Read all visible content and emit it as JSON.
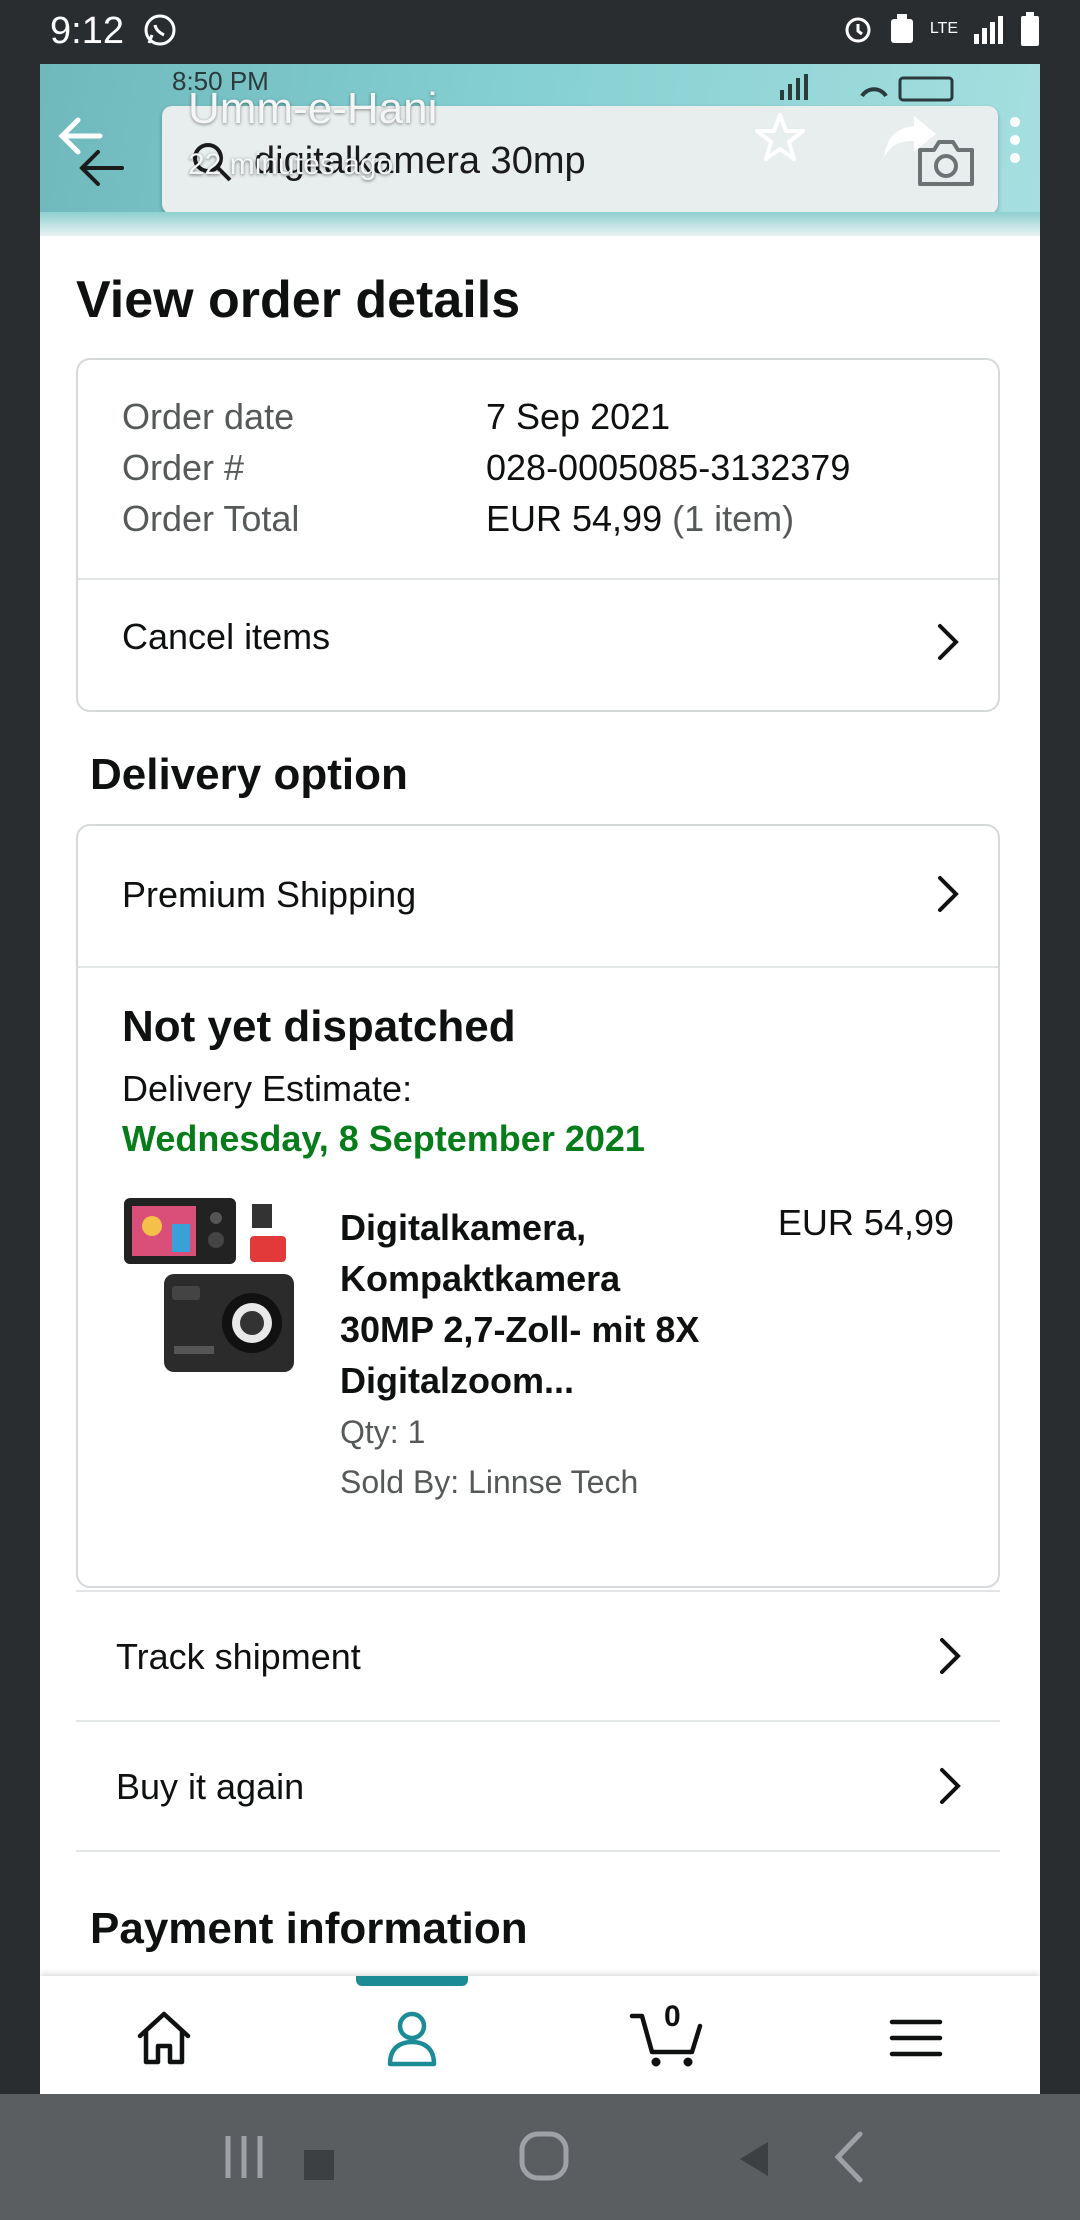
{
  "status_bar": {
    "time": "9:12",
    "network": "LTE"
  },
  "story_overlay": {
    "name": "Umm-e-Hani",
    "time_ago": "22 minutes ago"
  },
  "inner_status": {
    "time": "8:50 PM",
    "battery": "90"
  },
  "search": {
    "query": "digitalkamera 30mp"
  },
  "page": {
    "title": "View order details"
  },
  "order": {
    "date_label": "Order date",
    "date_value": "7 Sep 2021",
    "number_label": "Order #",
    "number_value": "028-0005085-3132379",
    "total_label": "Order Total",
    "total_value": "EUR 54,99",
    "total_items": "(1 item)",
    "cancel_label": "Cancel items"
  },
  "delivery": {
    "section_title": "Delivery option",
    "shipping_option": "Premium Shipping",
    "status": "Not yet dispatched",
    "estimate_label": "Delivery Estimate:",
    "estimate_date": "Wednesday, 8 September 2021",
    "product": {
      "title_lines": [
        "Digitalkamera,",
        "Kompaktkamera",
        "30MP 2,7-Zoll- mit 8X",
        "Digitalzoom..."
      ],
      "price": "EUR 54,99",
      "qty": "Qty: 1",
      "seller": "Sold By: Linnse Tech"
    }
  },
  "actions": {
    "track": "Track shipment",
    "buy_again": "Buy it again"
  },
  "payment": {
    "section_title": "Payment information"
  },
  "bottom_nav": {
    "items": [
      {
        "name": "home",
        "icon": "home-icon"
      },
      {
        "name": "account",
        "icon": "person-icon",
        "active": true
      },
      {
        "name": "cart",
        "icon": "cart-icon",
        "count": "0"
      },
      {
        "name": "menu",
        "icon": "hamburger-icon"
      }
    ]
  },
  "colors": {
    "accent": "#1b8b96",
    "delivery_green": "#067d1a",
    "header_teal": "#84cfd1"
  }
}
